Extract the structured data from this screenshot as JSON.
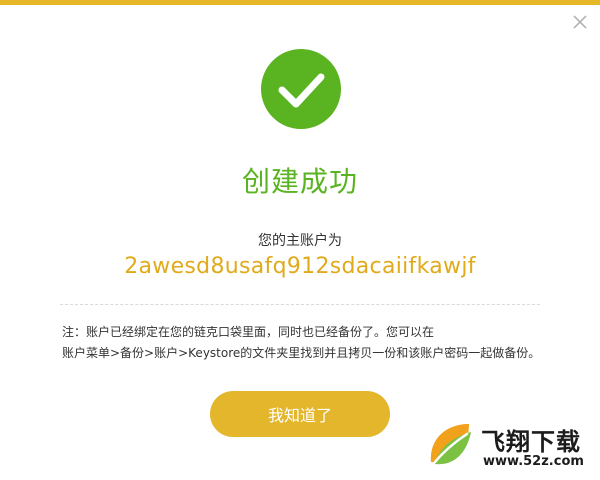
{
  "dialog": {
    "title": "创建成功",
    "account_label": "您的主账户为",
    "account_id": "2awesd8usafq912sdacaiifkawjf",
    "note_line1": "注：账户已经绑定在您的链克口袋里面，同时也已经备份了。您可以在",
    "note_line2": "账户菜单>备份>账户>Keystore的文件夹里找到并且拷贝一份和该账户密码一起做备份。",
    "confirm_button": "我知道了"
  },
  "watermark": {
    "brand": "飞翔下载",
    "url": "www.52z.com"
  },
  "icons": {
    "close": "close-icon",
    "success": "check-circle-icon",
    "logo": "leaf-logo-icon"
  },
  "colors": {
    "accent": "#e3b62c",
    "success": "#5ab320",
    "account_text": "#e0aa1a"
  }
}
